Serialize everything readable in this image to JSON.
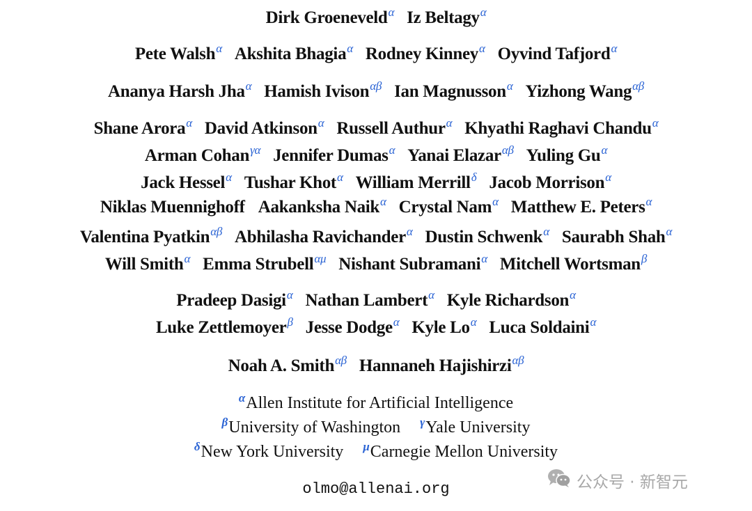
{
  "author_rows": [
    [
      {
        "name": "Dirk Groeneveld",
        "affil": "α"
      },
      {
        "name": "Iz Beltagy",
        "affil": "α"
      }
    ],
    [
      {
        "name": "Pete Walsh",
        "affil": "α"
      },
      {
        "name": "Akshita Bhagia",
        "affil": "α"
      },
      {
        "name": "Rodney Kinney",
        "affil": "α"
      },
      {
        "name": "Oyvind Tafjord",
        "affil": "α"
      }
    ],
    [
      {
        "name": "Ananya Harsh Jha",
        "affil": "α"
      },
      {
        "name": "Hamish Ivison",
        "affil": "αβ"
      },
      {
        "name": "Ian Magnusson",
        "affil": "α"
      },
      {
        "name": "Yizhong Wang",
        "affil": "αβ"
      }
    ],
    [
      {
        "name": "Shane Arora",
        "affil": "α"
      },
      {
        "name": "David Atkinson",
        "affil": "α"
      },
      {
        "name": "Russell Authur",
        "affil": "α"
      },
      {
        "name": "Khyathi Raghavi Chandu",
        "affil": "α"
      }
    ],
    [
      {
        "name": "Arman Cohan",
        "affil": "γα"
      },
      {
        "name": "Jennifer Dumas",
        "affil": "α"
      },
      {
        "name": "Yanai Elazar",
        "affil": "αβ"
      },
      {
        "name": "Yuling Gu",
        "affil": "α"
      }
    ],
    [
      {
        "name": "Jack Hessel",
        "affil": "α"
      },
      {
        "name": "Tushar Khot",
        "affil": "α"
      },
      {
        "name": "William Merrill",
        "affil": "δ"
      },
      {
        "name": "Jacob Morrison",
        "affil": "α"
      }
    ],
    [
      {
        "name": "Niklas Muennighoff",
        "affil": ""
      },
      {
        "name": "Aakanksha Naik",
        "affil": "α"
      },
      {
        "name": "Crystal Nam",
        "affil": "α"
      },
      {
        "name": "Matthew E. Peters",
        "affil": "α"
      }
    ],
    [
      {
        "name": "Valentina Pyatkin",
        "affil": "αβ"
      },
      {
        "name": "Abhilasha Ravichander",
        "affil": "α"
      },
      {
        "name": "Dustin Schwenk",
        "affil": "α"
      },
      {
        "name": "Saurabh Shah",
        "affil": "α"
      }
    ],
    [
      {
        "name": "Will Smith",
        "affil": "α"
      },
      {
        "name": "Emma Strubell",
        "affil": "αμ"
      },
      {
        "name": "Nishant Subramani",
        "affil": "α"
      },
      {
        "name": "Mitchell Wortsman",
        "affil": "β"
      }
    ],
    [
      {
        "name": "Pradeep Dasigi",
        "affil": "α"
      },
      {
        "name": "Nathan Lambert",
        "affil": "α"
      },
      {
        "name": "Kyle Richardson",
        "affil": "α"
      }
    ],
    [
      {
        "name": "Luke Zettlemoyer",
        "affil": "β"
      },
      {
        "name": "Jesse Dodge",
        "affil": "α"
      },
      {
        "name": "Kyle Lo",
        "affil": "α"
      },
      {
        "name": "Luca Soldaini",
        "affil": "α"
      }
    ],
    [
      {
        "name": "Noah A. Smith",
        "affil": "αβ"
      },
      {
        "name": "Hannaneh Hajishirzi",
        "affil": "αβ"
      }
    ]
  ],
  "affiliation_rows": [
    [
      {
        "mark": "α",
        "name": "Allen Institute for Artificial Intelligence"
      }
    ],
    [
      {
        "mark": "β",
        "name": "University of Washington"
      },
      {
        "mark": "γ",
        "name": "Yale University"
      }
    ],
    [
      {
        "mark": "δ",
        "name": "New York University"
      },
      {
        "mark": "μ",
        "name": "Carnegie Mellon University"
      }
    ]
  ],
  "email": "olmo@allenai.org",
  "watermark": {
    "icon": "wechat-icon",
    "text": "公众号 · 新智元"
  },
  "colors": {
    "affiliation_mark": "#2a63d4",
    "text": "#111111",
    "watermark": "#a8a8a8"
  }
}
